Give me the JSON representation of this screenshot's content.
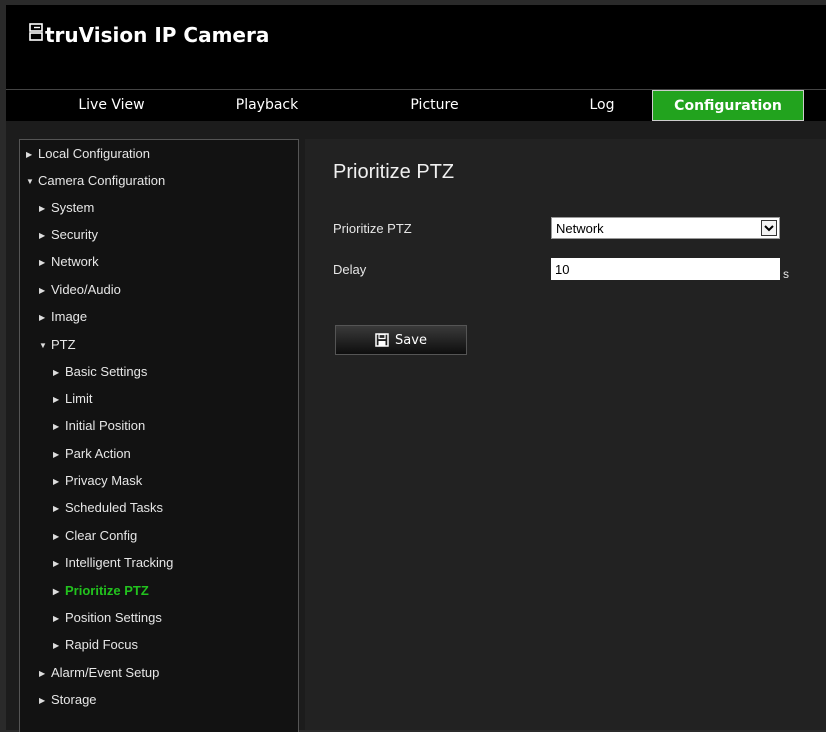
{
  "app": {
    "title": "truVision IP Camera"
  },
  "nav": {
    "tabs": [
      {
        "label": "Live View"
      },
      {
        "label": "Playback"
      },
      {
        "label": "Picture"
      },
      {
        "label": "Log"
      },
      {
        "label": "Configuration",
        "active": true
      }
    ]
  },
  "sidebar": {
    "items": [
      {
        "label": "Local Configuration",
        "expanded": false
      },
      {
        "label": "Camera Configuration",
        "expanded": true
      },
      {
        "label": "System",
        "expanded": false
      },
      {
        "label": "Security",
        "expanded": false
      },
      {
        "label": "Network",
        "expanded": false
      },
      {
        "label": "Video/Audio",
        "expanded": false
      },
      {
        "label": "Image",
        "expanded": false
      },
      {
        "label": "PTZ",
        "expanded": true
      },
      {
        "label": "Basic Settings",
        "expanded": false
      },
      {
        "label": "Limit",
        "expanded": false
      },
      {
        "label": "Initial Position",
        "expanded": false
      },
      {
        "label": "Park Action",
        "expanded": false
      },
      {
        "label": "Privacy Mask",
        "expanded": false
      },
      {
        "label": "Scheduled Tasks",
        "expanded": false
      },
      {
        "label": "Clear Config",
        "expanded": false
      },
      {
        "label": "Intelligent Tracking",
        "expanded": false
      },
      {
        "label": "Prioritize PTZ",
        "expanded": false,
        "active": true
      },
      {
        "label": "Position Settings",
        "expanded": false
      },
      {
        "label": "Rapid Focus",
        "expanded": false
      },
      {
        "label": "Alarm/Event Setup",
        "expanded": false
      },
      {
        "label": "Storage",
        "expanded": false
      }
    ]
  },
  "main": {
    "title": "Prioritize PTZ",
    "prioritize_label": "Prioritize PTZ",
    "prioritize_value": "Network",
    "delay_label": "Delay",
    "delay_value": "10",
    "delay_unit": "s",
    "save_label": "Save"
  },
  "colors": {
    "accent": "#22a31e",
    "active_text": "#22c21e",
    "background": "#222222",
    "sidebar_background": "#121212",
    "header_background": "#000000"
  },
  "icons": {
    "logo": "camera-logo-icon",
    "expand": "triangle-right-icon",
    "expanded": "triangle-down-icon",
    "dropdown": "chevron-down-icon",
    "save": "floppy-disk-icon"
  }
}
